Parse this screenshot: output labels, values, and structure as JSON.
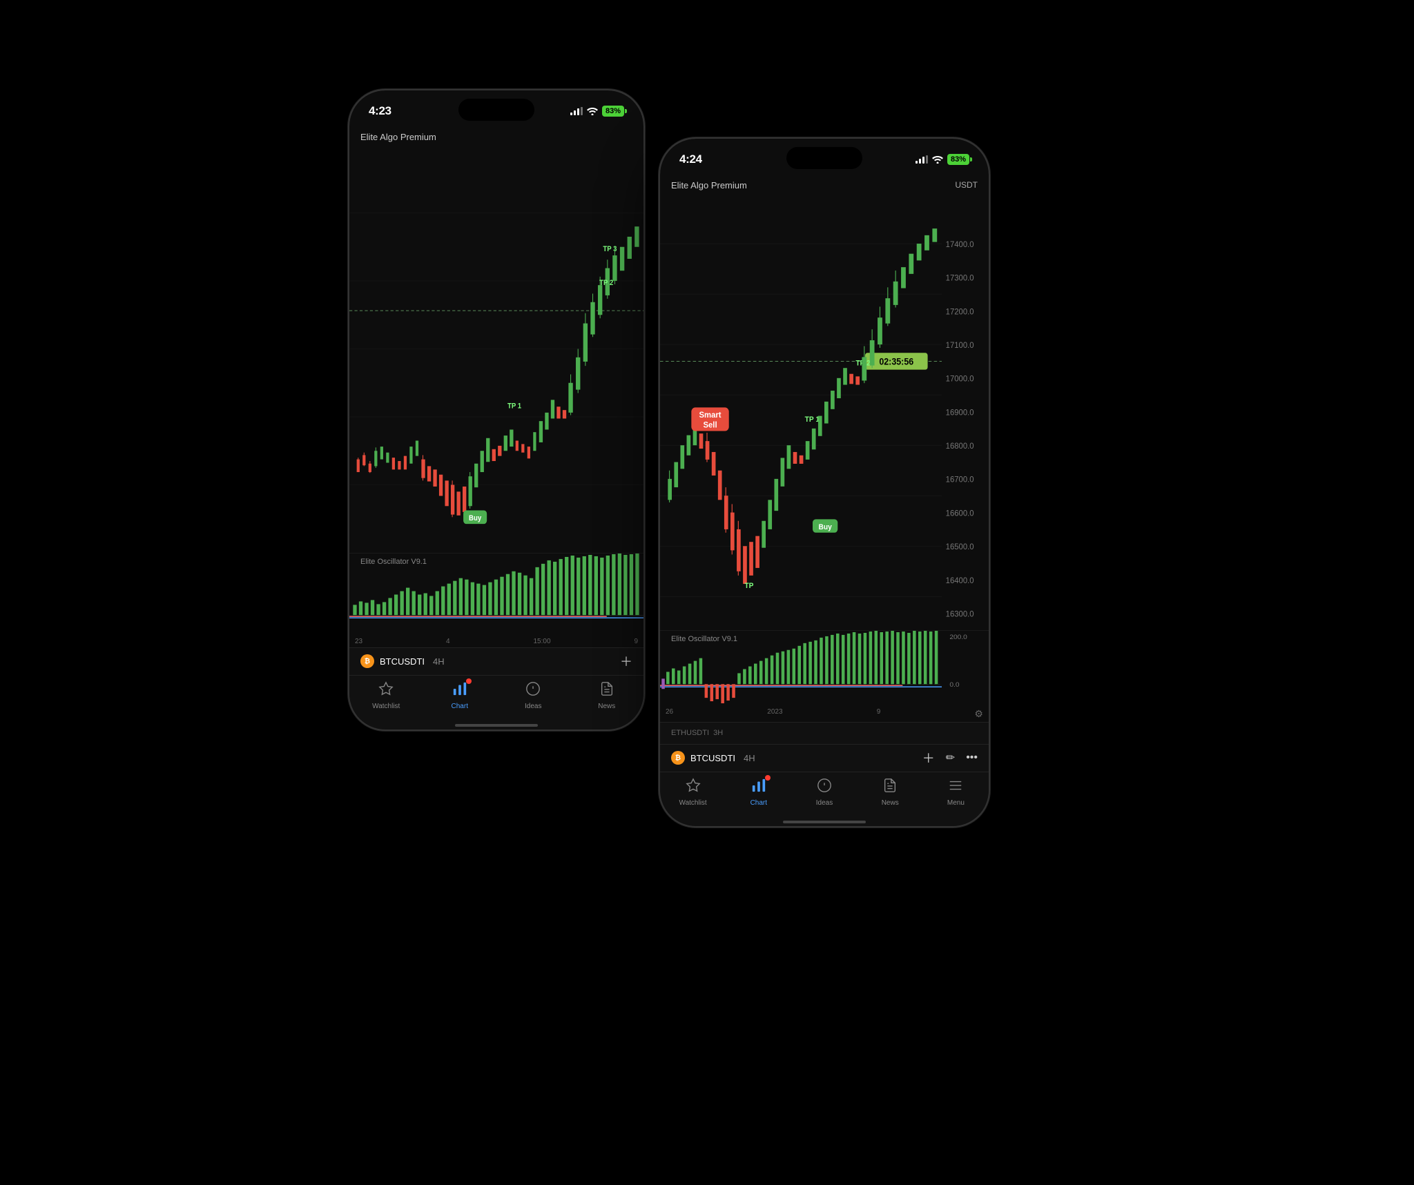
{
  "scene": {
    "background": "#000"
  },
  "phone_left": {
    "status": {
      "time": "4:23",
      "signal": "3bars",
      "wifi": true,
      "battery": "83%"
    },
    "chart": {
      "title": "Elite Algo Premium",
      "tp_labels": [
        "TP 3",
        "TP 2",
        "TP 1"
      ],
      "buy_label": "Buy",
      "oscillator_title": "Elite Oscillator V9.1",
      "ticker": "BTCUSDTI",
      "timeframe": "4H",
      "time_labels": [
        "23",
        "4",
        "15:00",
        "9"
      ]
    },
    "nav": {
      "items": [
        {
          "label": "Watchlist",
          "active": false
        },
        {
          "label": "Chart",
          "active": true
        },
        {
          "label": "Ideas",
          "active": false
        },
        {
          "label": "News",
          "active": false
        }
      ]
    }
  },
  "phone_right": {
    "status": {
      "time": "4:24",
      "signal": "3bars",
      "wifi": true,
      "battery": "83%"
    },
    "chart": {
      "title": "Elite Algo Premium",
      "currency": "USDT",
      "tp_labels": [
        "TP 1",
        "TP 2"
      ],
      "buy_label": "Buy",
      "smart_sell_label": "Smart Sell",
      "timer": "02:35:56",
      "price_levels": [
        "17400.0",
        "17300.0",
        "17200.0",
        "17100.0",
        "17000.0",
        "16900.0",
        "16800.0",
        "16700.0",
        "16600.0",
        "16500.0",
        "16400.0",
        "16300.0"
      ],
      "oscillator_title": "Elite Oscillator V9.1",
      "oscillator_value": "0.0",
      "oscillator_top": "200.0",
      "ticker": "BTCUSDTI",
      "timeframe": "4H",
      "time_labels": [
        "26",
        "2023",
        "9"
      ]
    },
    "nav": {
      "items": [
        {
          "label": "Watchlist",
          "active": false
        },
        {
          "label": "Chart",
          "active": true
        },
        {
          "label": "Ideas",
          "active": false
        },
        {
          "label": "News",
          "active": false
        },
        {
          "label": "Menu",
          "active": false
        }
      ]
    }
  }
}
